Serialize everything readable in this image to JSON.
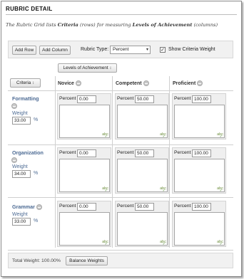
{
  "title": "RUBRIC DETAIL",
  "intro": {
    "prefix": "The Rubric Grid lists",
    "criteria_word": "Criteria",
    "middle": "(rows) for measuring",
    "levels_word": "Levels of Achievement",
    "suffix": "(columns)"
  },
  "toolbar": {
    "add_row": "Add Row",
    "add_column": "Add Column",
    "rubric_type_label": "Rubric Type:",
    "rubric_type_value": "Percent",
    "show_weight_label": "Show Criteria Weight",
    "show_weight_checked": true
  },
  "grid": {
    "levels_button": "Levels of Achievement",
    "criteria_button": "Criteria",
    "sort_glyph": "↕",
    "percent_label": "Percent",
    "weight_label": "Weight",
    "percent_sign": "%",
    "spell_icon_text": "abc",
    "columns": [
      "Novice",
      "Competent",
      "Proficient"
    ],
    "rows": [
      {
        "name": "Formatting",
        "weight": "33.00",
        "percents": [
          "0.00",
          "50.00",
          "100.00"
        ]
      },
      {
        "name": "Organization",
        "weight": "34.00",
        "percents": [
          "0.00",
          "50.00",
          "100.00"
        ]
      },
      {
        "name": "Grammar",
        "weight": "33.00",
        "percents": [
          "0.00",
          "50.00",
          "100.00"
        ]
      }
    ]
  },
  "footer": {
    "total_weight_text": "Total Weight:  100.00%",
    "balance_button": "Balance Weights"
  }
}
